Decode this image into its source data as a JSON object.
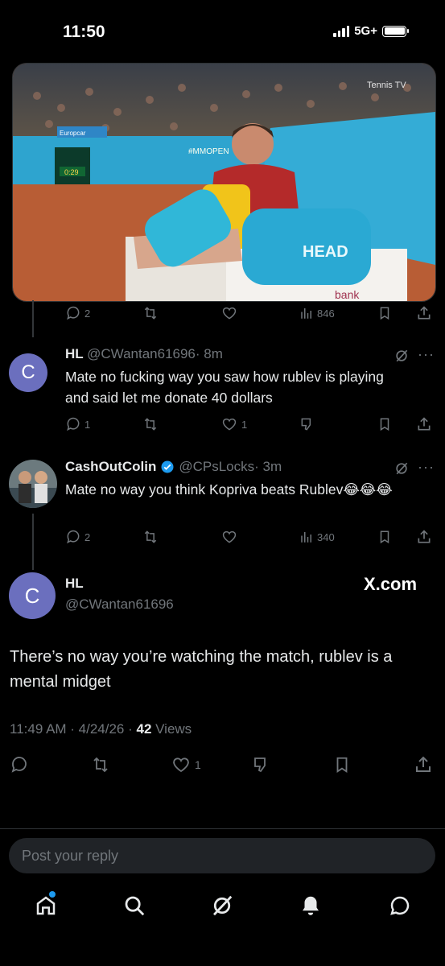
{
  "status_bar": {
    "time": "11:50",
    "network": "5G+"
  },
  "media": {
    "watermark": "Tennis TV",
    "banner": "#MMOPEN",
    "clock": "0:29",
    "sponsor": "Europcar"
  },
  "tweet_above": {
    "replies": "2",
    "views": "846"
  },
  "reply1": {
    "avatar_letter": "C",
    "name": "HL",
    "handle": "@CWantan61696",
    "time": "· 8m",
    "text": "Mate no fucking way you saw how rublev is playing and said let me donate 40 dollars",
    "replies": "1",
    "likes": "1"
  },
  "reply2": {
    "name": "CashOutColin",
    "handle": "@CPsLocks",
    "time": "· 3m",
    "text": "Mate no way you think Kopriva beats Rublev😂😂😂",
    "replies": "2",
    "views": "340"
  },
  "main": {
    "avatar_letter": "C",
    "name": "HL",
    "handle": "@CWantan61696",
    "watermark": "X.com",
    "text": "There’s no way you’re watching the match, rublev is a mental midget",
    "timestamp": "11:49 AM · 4/24/26 · ",
    "views_count": "42",
    "views_label": " Views",
    "likes": "1"
  },
  "reply_box": {
    "placeholder": "Post your reply"
  },
  "colors": {
    "accent": "#1d9bf0",
    "muted": "#71767b",
    "avatar": "#6b6fbe",
    "verified": "#1d9bf0"
  },
  "icons": [
    "reply-icon",
    "repost-icon",
    "like-icon",
    "views-icon",
    "bookmark-icon",
    "share-icon",
    "grok-icon",
    "more-icon",
    "downvote-icon",
    "home-icon",
    "search-icon",
    "grok-nav-icon",
    "notifications-icon",
    "messages-icon"
  ]
}
